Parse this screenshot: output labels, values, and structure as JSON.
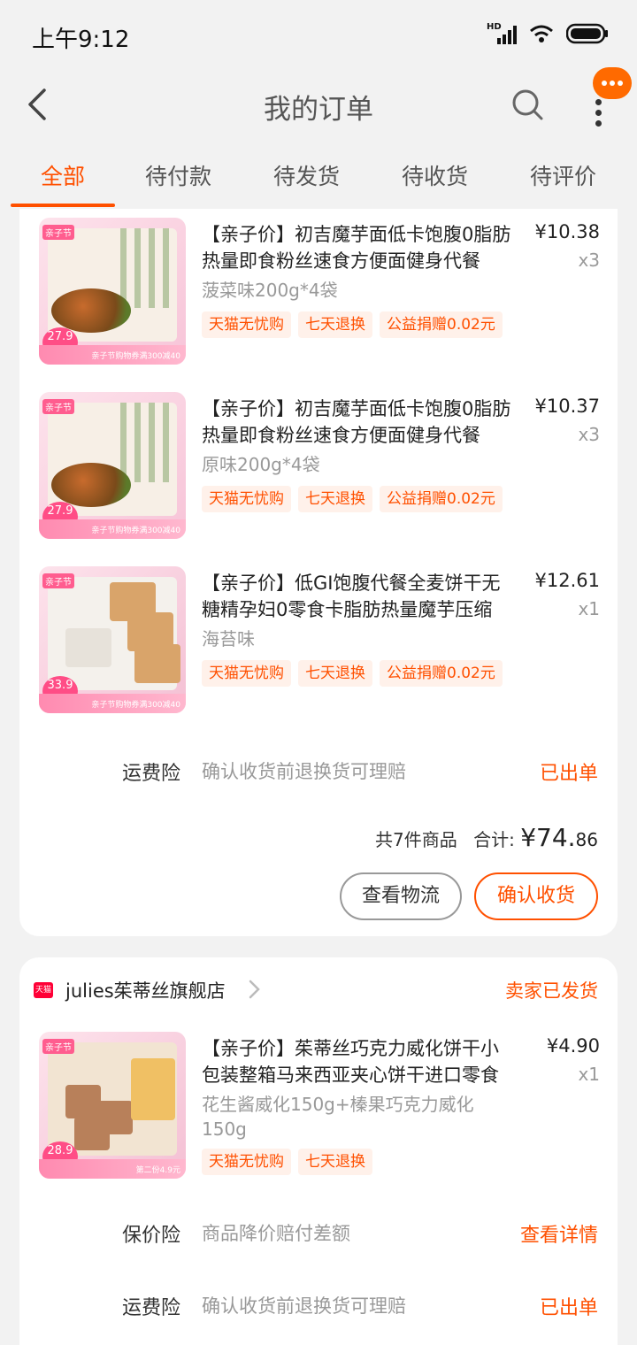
{
  "status_bar": {
    "time": "上午9:12",
    "hd": "HD"
  },
  "nav": {
    "title": "我的订单"
  },
  "tabs": [
    {
      "label": "全部",
      "active": true
    },
    {
      "label": "待付款",
      "active": false
    },
    {
      "label": "待发货",
      "active": false
    },
    {
      "label": "待收货",
      "active": false
    },
    {
      "label": "待评价",
      "active": false
    }
  ],
  "order1": {
    "items": [
      {
        "title": "【亲子价】初吉魔芋面低卡饱腹0脂肪热量即食粉丝速食方便面健身代餐",
        "spec": "菠菜味200g*4袋",
        "price": "¥10.38",
        "qty": "x3",
        "badges": [
          "天猫无忧购",
          "七天退换",
          "公益捐赠0.02元"
        ],
        "thumb_price": "27.9",
        "thumb_tag": "亲子节",
        "thumb_banner": "亲子节购物券满300减40"
      },
      {
        "title": "【亲子价】初吉魔芋面低卡饱腹0脂肪热量即食粉丝速食方便面健身代餐",
        "spec": "原味200g*4袋",
        "price": "¥10.37",
        "qty": "x3",
        "badges": [
          "天猫无忧购",
          "七天退换",
          "公益捐赠0.02元"
        ],
        "thumb_price": "27.9",
        "thumb_tag": "亲子节",
        "thumb_banner": "亲子节购物券满300减40"
      },
      {
        "title": "【亲子价】低GI饱腹代餐全麦饼干无糖精孕妇0零食卡脂肪热量魔芋压缩",
        "spec": "海苔味",
        "price": "¥12.61",
        "qty": "x1",
        "badges": [
          "天猫无忧购",
          "七天退换",
          "公益捐赠0.02元"
        ],
        "thumb_price": "33.9",
        "thumb_tag": "亲子节",
        "thumb_banner": "亲子节购物券满300减40"
      }
    ],
    "insurance": {
      "label": "运费险",
      "desc": "确认收货前退换货可理赔",
      "status": "已出单"
    },
    "summary": {
      "count_text": "共7件商品",
      "total_label": "合计:",
      "currency": "¥",
      "amount_int": "74.",
      "amount_dec": "86"
    },
    "buttons": {
      "logistics": "查看物流",
      "confirm": "确认收货"
    }
  },
  "order2": {
    "shop_badge": "天猫",
    "shop_name": "julies茱蒂丝旗舰店",
    "status": "卖家已发货",
    "item": {
      "title": "【亲子价】茱蒂丝巧克力威化饼干小包装整箱马来西亚夹心饼干进口零食",
      "spec": "花生酱威化150g+榛果巧克力威化150g",
      "price": "¥4.90",
      "qty": "x1",
      "badges": [
        "天猫无忧购",
        "七天退换"
      ],
      "thumb_price": "28.9",
      "thumb_tag": "亲子节",
      "thumb_banner": "第二份4.9元"
    },
    "price_protect": {
      "label": "保价险",
      "desc": "商品降价赔付差额",
      "action": "查看详情"
    },
    "insurance": {
      "label": "运费险",
      "desc": "确认收货前退换货可理赔",
      "status": "已出单"
    }
  },
  "colors": {
    "accent": "#ff5000",
    "background": "#f2f2f2"
  }
}
